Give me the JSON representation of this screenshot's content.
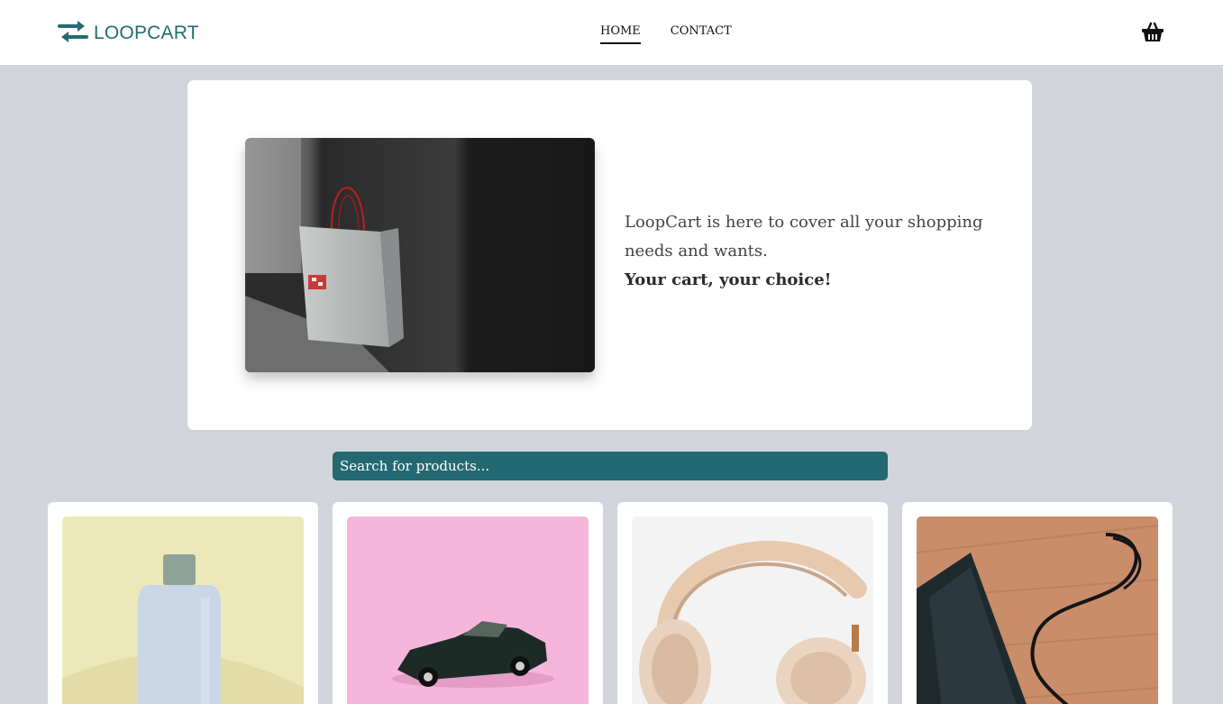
{
  "header": {
    "logo_text": "LOOPCART",
    "nav": [
      {
        "label": "HOME",
        "active": true
      },
      {
        "label": "CONTACT",
        "active": false
      }
    ],
    "cart_icon": "basket-icon",
    "brand_color": "#216b74"
  },
  "hero": {
    "text": "LoopCart is here to cover all your shopping needs and wants.",
    "tagline": "Your cart, your choice!"
  },
  "search": {
    "placeholder": "Search for products...",
    "color": "#246972"
  },
  "products": [
    {
      "image": "cologne-bottle-photo"
    },
    {
      "image": "toy-car-photo"
    },
    {
      "image": "headphones-photo"
    },
    {
      "image": "power-bank-photo"
    }
  ]
}
